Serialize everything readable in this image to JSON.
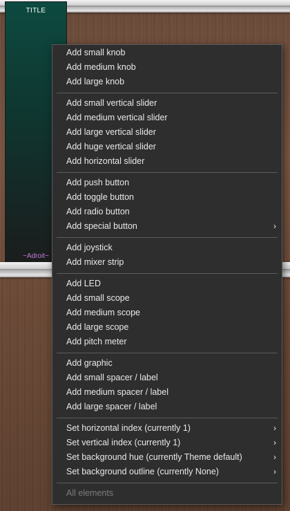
{
  "strip": {
    "title": "TITLE",
    "footer": "~Adroit~"
  },
  "menu": {
    "groups": [
      [
        "Add small knob",
        "Add medium knob",
        "Add large knob"
      ],
      [
        "Add small vertical slider",
        "Add medium vertical slider",
        "Add large vertical slider",
        "Add huge vertical slider",
        "Add horizontal slider"
      ],
      [
        "Add push button",
        "Add toggle button",
        "Add radio button",
        "Add special button"
      ],
      [
        "Add joystick",
        "Add mixer strip"
      ],
      [
        "Add LED",
        "Add small scope",
        "Add medium scope",
        "Add large scope",
        "Add pitch meter"
      ],
      [
        "Add graphic",
        "Add small spacer / label",
        "Add medium spacer / label",
        "Add large spacer / label"
      ],
      [
        "Set horizontal index (currently 1)",
        "Set vertical index (currently 1)",
        "Set background hue (currently Theme default)",
        "Set background outline (currently None)"
      ],
      [
        "All elements"
      ]
    ],
    "submenu_chevron": "›"
  }
}
